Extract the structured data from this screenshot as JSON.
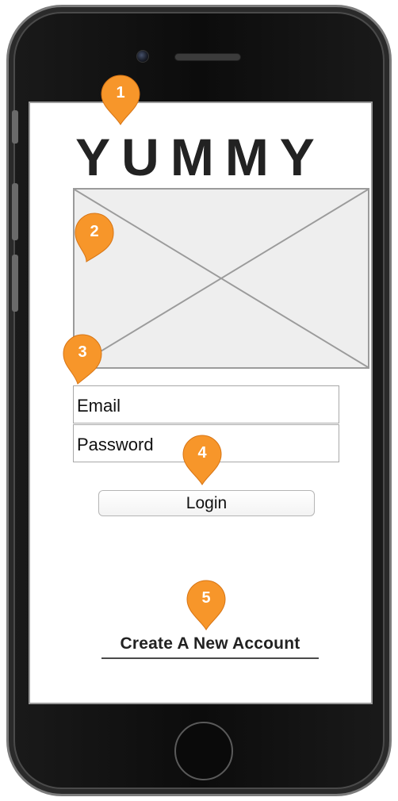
{
  "app": {
    "logo_text": "YUMMY"
  },
  "login_form": {
    "email_placeholder": "Email",
    "password_placeholder": "Password",
    "login_label": "Login",
    "create_account_label": "Create A New Account"
  },
  "annotations": {
    "markers": [
      "1",
      "2",
      "3",
      "4",
      "5"
    ]
  },
  "colors": {
    "marker_orange": "#F7962A",
    "phone_body": "#111111",
    "placeholder_fill": "#EEEEEE"
  },
  "icons": {
    "image_placeholder": "image-placeholder-icon",
    "camera": "camera-icon",
    "home": "home-button-icon"
  }
}
